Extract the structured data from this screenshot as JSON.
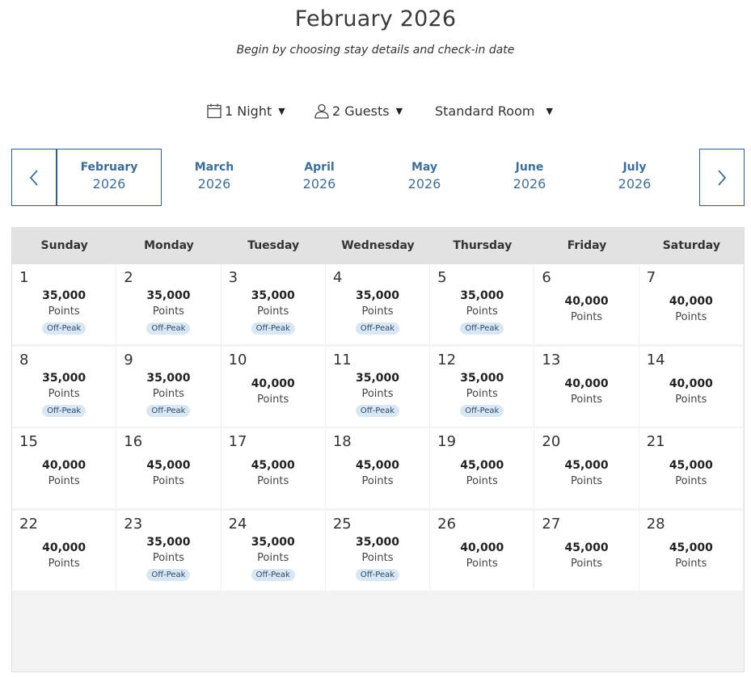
{
  "header": {
    "title": "February 2026",
    "subtitle": "Begin by choosing stay details and check-in date"
  },
  "filters": {
    "nights": "1 Night",
    "guests": "2 Guests",
    "room": "Standard Room"
  },
  "months": [
    {
      "name": "February",
      "year": "2026",
      "selected": true
    },
    {
      "name": "March",
      "year": "2026",
      "selected": false
    },
    {
      "name": "April",
      "year": "2026",
      "selected": false
    },
    {
      "name": "May",
      "year": "2026",
      "selected": false
    },
    {
      "name": "June",
      "year": "2026",
      "selected": false
    },
    {
      "name": "July",
      "year": "2026",
      "selected": false
    }
  ],
  "weekdays": [
    "Sunday",
    "Monday",
    "Tuesday",
    "Wednesday",
    "Thursday",
    "Friday",
    "Saturday"
  ],
  "points_label": "Points",
  "off_peak_label": "Off-Peak",
  "days": [
    {
      "day": "1",
      "points": "35,000",
      "off_peak": true
    },
    {
      "day": "2",
      "points": "35,000",
      "off_peak": true
    },
    {
      "day": "3",
      "points": "35,000",
      "off_peak": true
    },
    {
      "day": "4",
      "points": "35,000",
      "off_peak": true
    },
    {
      "day": "5",
      "points": "35,000",
      "off_peak": true
    },
    {
      "day": "6",
      "points": "40,000",
      "off_peak": false
    },
    {
      "day": "7",
      "points": "40,000",
      "off_peak": false
    },
    {
      "day": "8",
      "points": "35,000",
      "off_peak": true
    },
    {
      "day": "9",
      "points": "35,000",
      "off_peak": true
    },
    {
      "day": "10",
      "points": "40,000",
      "off_peak": false
    },
    {
      "day": "11",
      "points": "35,000",
      "off_peak": true
    },
    {
      "day": "12",
      "points": "35,000",
      "off_peak": true
    },
    {
      "day": "13",
      "points": "40,000",
      "off_peak": false
    },
    {
      "day": "14",
      "points": "40,000",
      "off_peak": false
    },
    {
      "day": "15",
      "points": "40,000",
      "off_peak": false
    },
    {
      "day": "16",
      "points": "45,000",
      "off_peak": false
    },
    {
      "day": "17",
      "points": "45,000",
      "off_peak": false
    },
    {
      "day": "18",
      "points": "45,000",
      "off_peak": false
    },
    {
      "day": "19",
      "points": "45,000",
      "off_peak": false
    },
    {
      "day": "20",
      "points": "45,000",
      "off_peak": false
    },
    {
      "day": "21",
      "points": "45,000",
      "off_peak": false
    },
    {
      "day": "22",
      "points": "40,000",
      "off_peak": false
    },
    {
      "day": "23",
      "points": "35,000",
      "off_peak": true
    },
    {
      "day": "24",
      "points": "35,000",
      "off_peak": true
    },
    {
      "day": "25",
      "points": "35,000",
      "off_peak": true
    },
    {
      "day": "26",
      "points": "40,000",
      "off_peak": false
    },
    {
      "day": "27",
      "points": "45,000",
      "off_peak": false
    },
    {
      "day": "28",
      "points": "45,000",
      "off_peak": false
    }
  ],
  "icons": {
    "calendar": "calendar-icon",
    "guests": "user-icon",
    "prev": "chevron-left-icon",
    "next": "chevron-right-icon",
    "dropdown": "caret-down-icon"
  },
  "colors": {
    "accent": "#3d6f99",
    "border_accent": "#2e5e8a",
    "off_peak_bg": "#d9e7f4",
    "header_bg": "#e2e2e2"
  }
}
